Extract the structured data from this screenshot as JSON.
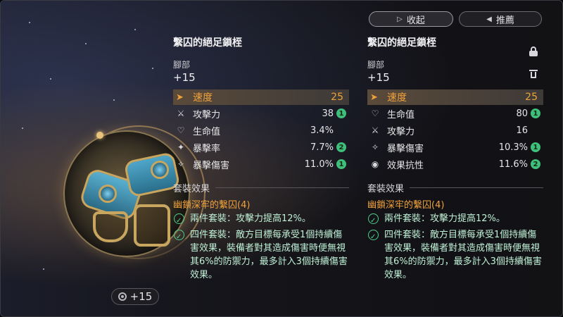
{
  "header": {
    "collapse_label": "收起",
    "recommend_label": "推薦"
  },
  "item_art": {
    "level_label": "+15"
  },
  "left_panel": {
    "item_name": "繫囚的絕足鎖桎",
    "slot": "腳部",
    "level": "+15",
    "main_stat": {
      "icon": "speed-icon",
      "name": "速度",
      "value": "25"
    },
    "sub_stats": [
      {
        "icon": "attack-icon",
        "name": "攻擊力",
        "value": "38",
        "badge": "1"
      },
      {
        "icon": "hp-icon",
        "name": "生命值",
        "value": "3.4%",
        "badge": ""
      },
      {
        "icon": "crit-rate-icon",
        "name": "暴擊率",
        "value": "7.7%",
        "badge": "2"
      },
      {
        "icon": "crit-dmg-icon",
        "name": "暴擊傷害",
        "value": "11.0%",
        "badge": "1"
      }
    ],
    "set_header": "套裝效果",
    "set_name": "幽鎖深牢的繫囚(4)",
    "effects": [
      "兩件套裝：攻擊力提高12%。",
      "四件套裝：敵方目標每承受1個持續傷害效果，裝備者對其造成傷害時便無視其6%的防禦力，最多計入3個持續傷害效果。"
    ]
  },
  "right_panel": {
    "item_name": "繫囚的絕足鎖桎",
    "slot": "腳部",
    "level": "+15",
    "main_stat": {
      "icon": "speed-icon",
      "name": "速度",
      "value": "25"
    },
    "sub_stats": [
      {
        "icon": "hp-icon",
        "name": "生命值",
        "value": "80",
        "badge": "1"
      },
      {
        "icon": "attack-icon",
        "name": "攻擊力",
        "value": "16",
        "badge": ""
      },
      {
        "icon": "crit-dmg-icon",
        "name": "暴擊傷害",
        "value": "10.3%",
        "badge": "1"
      },
      {
        "icon": "effect-res-icon",
        "name": "效果抗性",
        "value": "11.6%",
        "badge": "2"
      }
    ],
    "set_header": "套裝效果",
    "set_name": "幽鎖深牢的繫囚(4)",
    "effects": [
      "兩件套裝：攻擊力提高12%。",
      "四件套裝：敵方目標每承受1個持續傷害效果，裝備者對其造成傷害時便無視其6%的防禦力，最多計入3個持續傷害效果。"
    ]
  },
  "colors": {
    "accent_orange": "#f0a23a",
    "badge_green": "#3fbf7a",
    "effect_green": "#4fd08a"
  }
}
